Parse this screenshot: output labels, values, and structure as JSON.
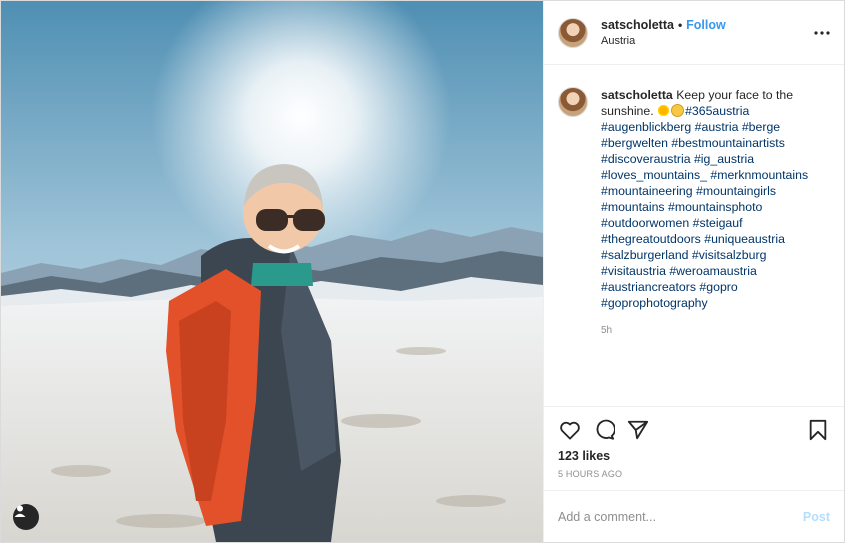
{
  "photo": {
    "alt_icon": "user-tag-icon"
  },
  "header": {
    "username": "satscholetta",
    "separator": "•",
    "follow_label": "Follow",
    "location": "Austria",
    "more_icon": "more-options-icon"
  },
  "caption": {
    "username": "satscholetta",
    "text": "Keep your face to the sunshine.",
    "emojis": [
      "sun-emoji",
      "smiling-face-emoji"
    ],
    "hashtags": "#365austria #augenblickberg #austria #berge #bergwelten #bestmountainartists #discoveraustria #ig_austria #loves_mountains_ #merknmountains #mountaineering #mountaingirls #mountains #mountainsphoto #outdoorwomen #steigauf #thegreatoutdoors #uniqueaustria #salzburgerland #visitsalzburg #visitaustria #weroamaustria #austriancreators #gopro #goprophotography",
    "time": "5h"
  },
  "actions": {
    "icons": [
      "heart-icon",
      "comment-icon",
      "share-icon",
      "bookmark-icon"
    ],
    "likes": "123 likes",
    "posted_ago": "5 HOURS AGO"
  },
  "comment": {
    "placeholder": "Add a comment...",
    "post_label": "Post"
  },
  "colors": {
    "accent": "#3897f0",
    "post_disabled": "#b2dffc",
    "hashtag": "#003569",
    "muted": "#8e8e8e"
  }
}
